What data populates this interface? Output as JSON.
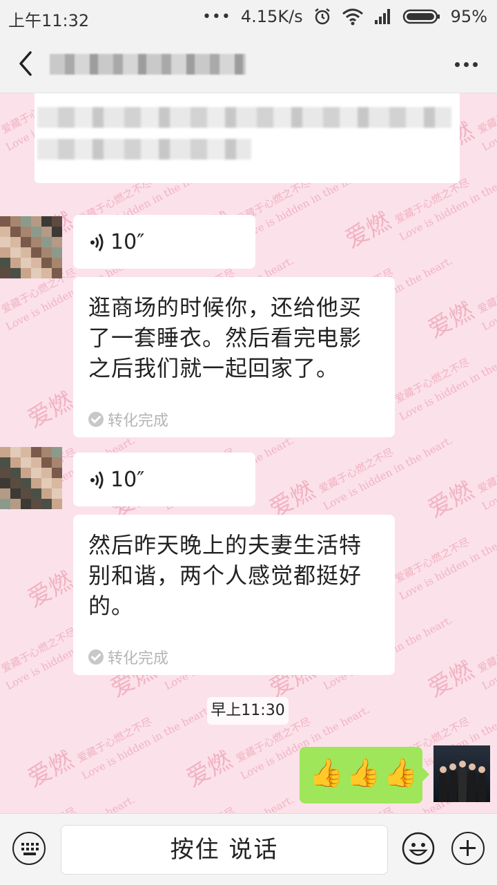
{
  "status_bar": {
    "time": "上午11:32",
    "net_speed": "4.15K/s",
    "battery": "95%"
  },
  "header": {
    "more_label": "…"
  },
  "messages": [
    {
      "type": "voice",
      "duration": "10″"
    },
    {
      "type": "text",
      "text": "逛商场的时候你，还给他买了一套睡衣。然后看完电影之后我们就一起回家了。",
      "status": "转化完成"
    },
    {
      "type": "voice",
      "duration": "10″"
    },
    {
      "type": "text",
      "text": "然后昨天晚上的夫妻生活特别和谐，两个人感觉都挺好的。",
      "status": "转化完成"
    }
  ],
  "timestamp": "早上11:30",
  "my_message": {
    "emojis": [
      "👍",
      "👍",
      "👍"
    ]
  },
  "input_bar": {
    "hold_to_talk": "按住 说话"
  },
  "watermark": {
    "big": "爱燃",
    "small_1": "爱藏于心燃之不尽",
    "small_2": "Love is hidden in the heart."
  }
}
